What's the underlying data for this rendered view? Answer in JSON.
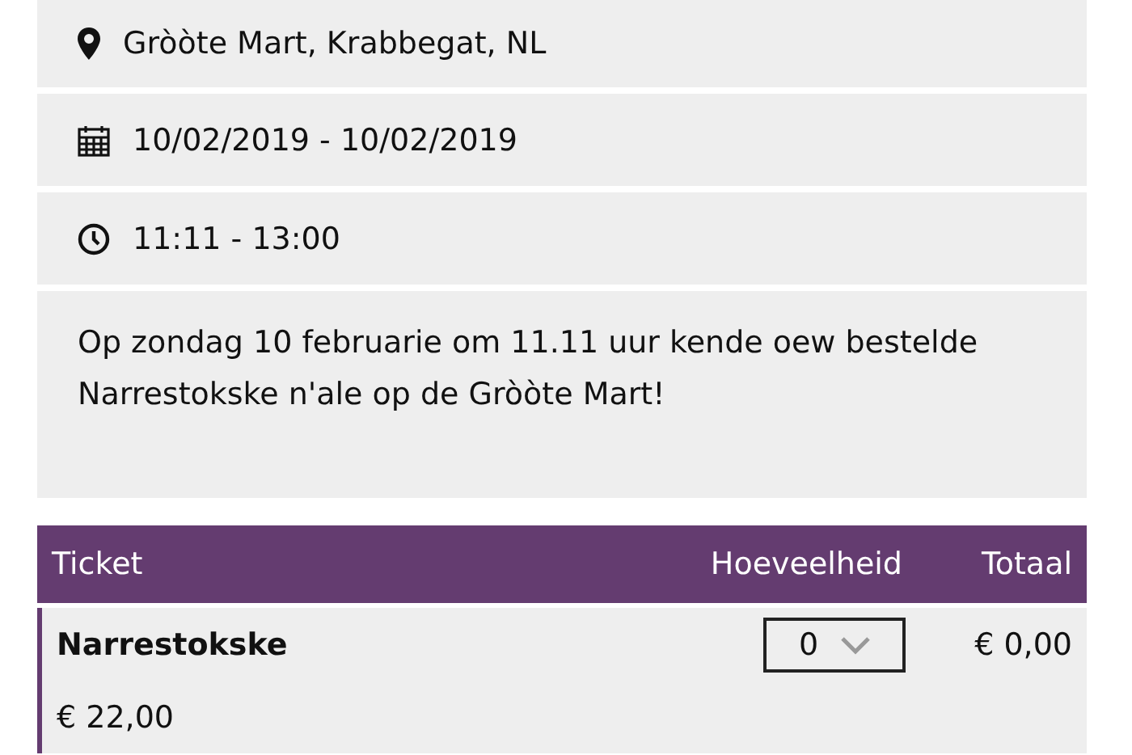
{
  "info": [
    {
      "kind": "location",
      "text": "Gròòte Mart, Krabbegat, NL"
    },
    {
      "kind": "date",
      "text": "10/02/2019 - 10/02/2019"
    },
    {
      "kind": "time",
      "text": "11:11 - 13:00"
    }
  ],
  "description": "Op zondag 10 februarie om 11.11 uur kende oew bestelde Narrestokske n'ale op de Gròòte Mart!",
  "table": {
    "columns": [
      "Ticket",
      "Hoeveelheid",
      "Totaal"
    ],
    "rows": [
      {
        "name": "Narrestokske",
        "price": "€ 22,00",
        "quantity": "0",
        "total": "€ 0,00"
      }
    ]
  }
}
